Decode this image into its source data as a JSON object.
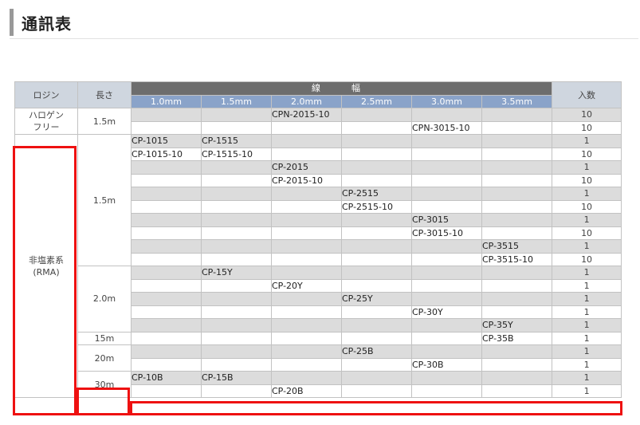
{
  "page_title": "通訊表",
  "table": {
    "header": {
      "rosin": "ロジン",
      "length": "長さ",
      "width_group": "線　幅",
      "widths": [
        "1.0mm",
        "1.5mm",
        "2.0mm",
        "2.5mm",
        "3.0mm",
        "3.5mm"
      ],
      "qty": "入数"
    },
    "rosin_labels": {
      "halogen_free": "ハロゲン\nフリー",
      "rma": "非塩素系\n(RMA)"
    },
    "length_labels": [
      "1.5m",
      "1.5m",
      "2.0m",
      "15m",
      "20m",
      "30m"
    ],
    "rows": [
      {
        "cells": [
          "",
          "",
          "CPN-2015-10",
          "",
          "",
          ""
        ],
        "qty": "10"
      },
      {
        "cells": [
          "",
          "",
          "",
          "",
          "CPN-3015-10",
          ""
        ],
        "qty": "10"
      },
      {
        "cells": [
          "CP-1015",
          "CP-1515",
          "",
          "",
          "",
          ""
        ],
        "qty": "1"
      },
      {
        "cells": [
          "CP-1015-10",
          "CP-1515-10",
          "",
          "",
          "",
          ""
        ],
        "qty": "10"
      },
      {
        "cells": [
          "",
          "",
          "CP-2015",
          "",
          "",
          ""
        ],
        "qty": "1"
      },
      {
        "cells": [
          "",
          "",
          "CP-2015-10",
          "",
          "",
          ""
        ],
        "qty": "10"
      },
      {
        "cells": [
          "",
          "",
          "",
          "CP-2515",
          "",
          ""
        ],
        "qty": "1"
      },
      {
        "cells": [
          "",
          "",
          "",
          "CP-2515-10",
          "",
          ""
        ],
        "qty": "10"
      },
      {
        "cells": [
          "",
          "",
          "",
          "",
          "CP-3015",
          ""
        ],
        "qty": "1"
      },
      {
        "cells": [
          "",
          "",
          "",
          "",
          "CP-3015-10",
          ""
        ],
        "qty": "10"
      },
      {
        "cells": [
          "",
          "",
          "",
          "",
          "",
          "CP-3515"
        ],
        "qty": "1"
      },
      {
        "cells": [
          "",
          "",
          "",
          "",
          "",
          "CP-3515-10"
        ],
        "qty": "10"
      },
      {
        "cells": [
          "",
          "CP-15Y",
          "",
          "",
          "",
          ""
        ],
        "qty": "1"
      },
      {
        "cells": [
          "",
          "",
          "CP-20Y",
          "",
          "",
          ""
        ],
        "qty": "1"
      },
      {
        "cells": [
          "",
          "",
          "",
          "CP-25Y",
          "",
          ""
        ],
        "qty": "1"
      },
      {
        "cells": [
          "",
          "",
          "",
          "",
          "CP-30Y",
          ""
        ],
        "qty": "1"
      },
      {
        "cells": [
          "",
          "",
          "",
          "",
          "",
          "CP-35Y"
        ],
        "qty": "1"
      },
      {
        "cells": [
          "",
          "",
          "",
          "",
          "",
          "CP-35B"
        ],
        "qty": "1"
      },
      {
        "cells": [
          "",
          "",
          "",
          "CP-25B",
          "",
          ""
        ],
        "qty": "1"
      },
      {
        "cells": [
          "",
          "",
          "",
          "",
          "CP-30B",
          ""
        ],
        "qty": "1"
      },
      {
        "cells": [
          "CP-10B",
          "CP-15B",
          "",
          "",
          "",
          ""
        ],
        "qty": "1"
      },
      {
        "cells": [
          "",
          "",
          "CP-20B",
          "",
          "",
          ""
        ],
        "qty": "1"
      }
    ]
  },
  "colors": {
    "highlight": "#e11111",
    "header_dark": "#6d6d6d",
    "header_blue": "#8aa3c9",
    "header_light": "#cfd6df",
    "row_gray": "#dcdcdc"
  }
}
